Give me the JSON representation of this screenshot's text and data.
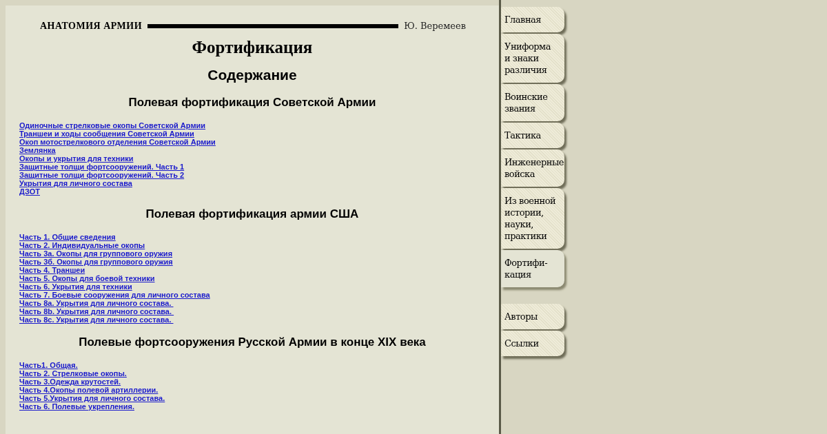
{
  "header": {
    "logo": "АНАТОМИЯ АРМИИ",
    "author": "Ю. Веремеев"
  },
  "title": "Фортификация",
  "subtitle": "Содержание",
  "sections": [
    {
      "heading": "Полевая фортификация Советской Армии",
      "links": [
        "Одиночные стрелковые окопы Советской Армии",
        "Траншеи и ходы сообщения Советской Армии",
        "Окоп мотострелкового отделения Советской Армии",
        "Землянка",
        "Окопы и укрытия для техники",
        "Защитные толщи фортсооружений. Часть 1",
        "Защитные толщи фортсооружений. Часть 2",
        "Укрытия для личного состава",
        "ДЗОТ"
      ]
    },
    {
      "heading": "Полевая фортификация армии США",
      "links": [
        "Часть 1. Общие сведения",
        "Часть 2. Индивидуальные окопы",
        "Часть 3а. Окопы для группового оружия",
        "Часть 3б. Окопы для группового оружия",
        "Часть 4. Траншеи",
        "Часть 5. Окопы для боевой техники",
        "Часть 6. Укрытия для техники",
        "Часть 7. Боевые сооружения для личного состава",
        "Часть 8а. Укрытия для личного состава. ",
        "Часть 8b. Укрытия для личного состава. ",
        "Часть 8c. Укрытия для личного состава. "
      ]
    },
    {
      "heading": "Полевые фортсооружения Русской Армии в конце XIX века",
      "links": [
        "Часть1. Общая.",
        "Часть 2. Стрелковые окопы.",
        "Часть 3.Одежда крутостей.",
        "Часть 4.Окопы полевой артиллерии.",
        "Часть 5.Укрытия для личного состава.",
        "Часть 6. Полевые укрепления."
      ]
    }
  ],
  "nav": [
    {
      "lines": [
        "Главная"
      ],
      "selected": false
    },
    {
      "lines": [
        "Униформа",
        "и знаки",
        "различия"
      ],
      "selected": false
    },
    {
      "lines": [
        "Воинские",
        "звания"
      ],
      "selected": false
    },
    {
      "lines": [
        "Тактика"
      ],
      "selected": false
    },
    {
      "lines": [
        "Инженерные",
        "войска"
      ],
      "selected": false
    },
    {
      "lines": [
        "Из военной",
        "истории,",
        "науки,",
        "практики"
      ],
      "selected": false
    },
    {
      "lines": [
        "Фортифи-",
        "кация"
      ],
      "selected": true
    },
    {
      "lines": [
        "Авторы"
      ],
      "selected": false,
      "gap_before": true
    },
    {
      "lines": [
        "Ссылки"
      ],
      "selected": false
    }
  ]
}
